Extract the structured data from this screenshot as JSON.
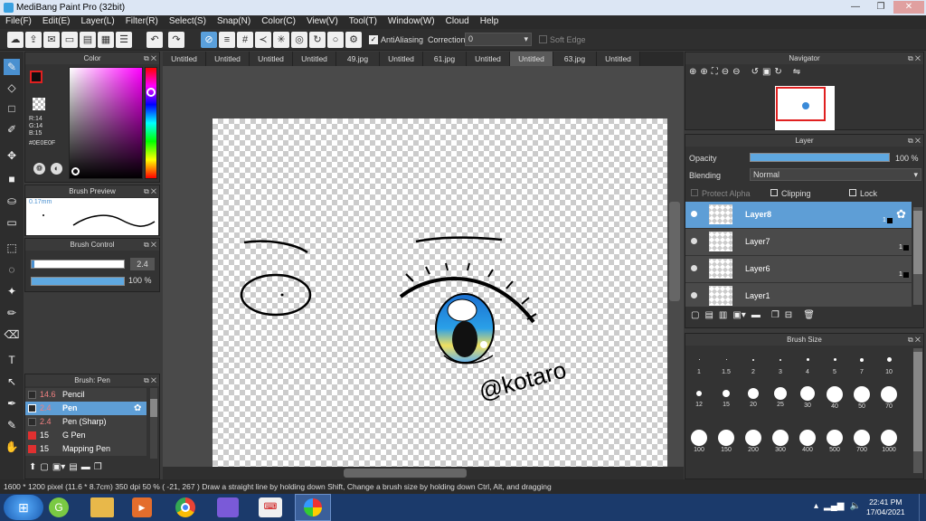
{
  "app": {
    "title": "MediBang Paint Pro (32bit)"
  },
  "menu": [
    "File(F)",
    "Edit(E)",
    "Layer(L)",
    "Filter(R)",
    "Select(S)",
    "Snap(N)",
    "Color(C)",
    "View(V)",
    "Tool(T)",
    "Window(W)",
    "Cloud",
    "Help"
  ],
  "toolbar": {
    "antialias_label": "AntiAliasing",
    "correction_label": "Correction",
    "correction_value": "0",
    "softedge_label": "Soft Edge"
  },
  "color_panel": {
    "title": "Color",
    "r": "R:14",
    "g": "G:14",
    "b": "B:15",
    "hex": "#0E0E0F",
    "primary": "#0E0E0F"
  },
  "brush_preview": {
    "title": "Brush Preview",
    "size": "0.17mm"
  },
  "brush_control": {
    "title": "Brush Control",
    "size": "2.4",
    "opacity": "100 %"
  },
  "brush_panel": {
    "title": "Brush: Pen",
    "items": [
      {
        "size": "14.6",
        "name": "Pencil",
        "color": "#2b2b2b"
      },
      {
        "size": "2.4",
        "name": "Pen",
        "color": "#2b2b2b"
      },
      {
        "size": "2.4",
        "name": "Pen (Sharp)",
        "color": "#2b2b2b"
      },
      {
        "size": "15",
        "name": "G Pen",
        "color": "#e03030"
      },
      {
        "size": "15",
        "name": "Mapping Pen",
        "color": "#e03030"
      }
    ]
  },
  "tabs": [
    "Untitled",
    "Untitled",
    "Untitled",
    "Untitled",
    "49.jpg",
    "Untitled",
    "61.jpg",
    "Untitled",
    "Untitled",
    "63.jpg",
    "Untitled"
  ],
  "active_tab": 8,
  "canvas": {
    "signature": "@kotaro"
  },
  "navigator": {
    "title": "Navigator"
  },
  "layer_panel": {
    "title": "Layer",
    "opacity_label": "Opacity",
    "opacity_value": "100 %",
    "blending_label": "Blending",
    "blending_value": "Normal",
    "protect_alpha": "Protect Alpha",
    "clipping": "Clipping",
    "lock": "Lock",
    "layers": [
      {
        "name": "Layer8",
        "num": "1"
      },
      {
        "name": "Layer7",
        "num": "1"
      },
      {
        "name": "Layer6",
        "num": "1"
      },
      {
        "name": "Layer1",
        "num": ""
      }
    ]
  },
  "brush_size": {
    "title": "Brush Size",
    "sizes": [
      "1",
      "1.5",
      "2",
      "3",
      "4",
      "5",
      "7",
      "10",
      "12",
      "15",
      "20",
      "25",
      "30",
      "40",
      "50",
      "70",
      "100",
      "150",
      "200",
      "300",
      "400",
      "500",
      "700",
      "1000"
    ]
  },
  "status": {
    "dimensions": "1600 * 1200 pixel",
    "physical": "(11.6 * 8.7cm)",
    "dpi": "350 dpi",
    "zoom": "50 %",
    "coords": "( -21, 267 )",
    "hint": "Draw a straight line by holding down Shift, Change a brush size by holding down Ctrl, Alt, and dragging"
  },
  "taskbar": {
    "time": "22:41 PM",
    "date": "17/04/2021"
  }
}
